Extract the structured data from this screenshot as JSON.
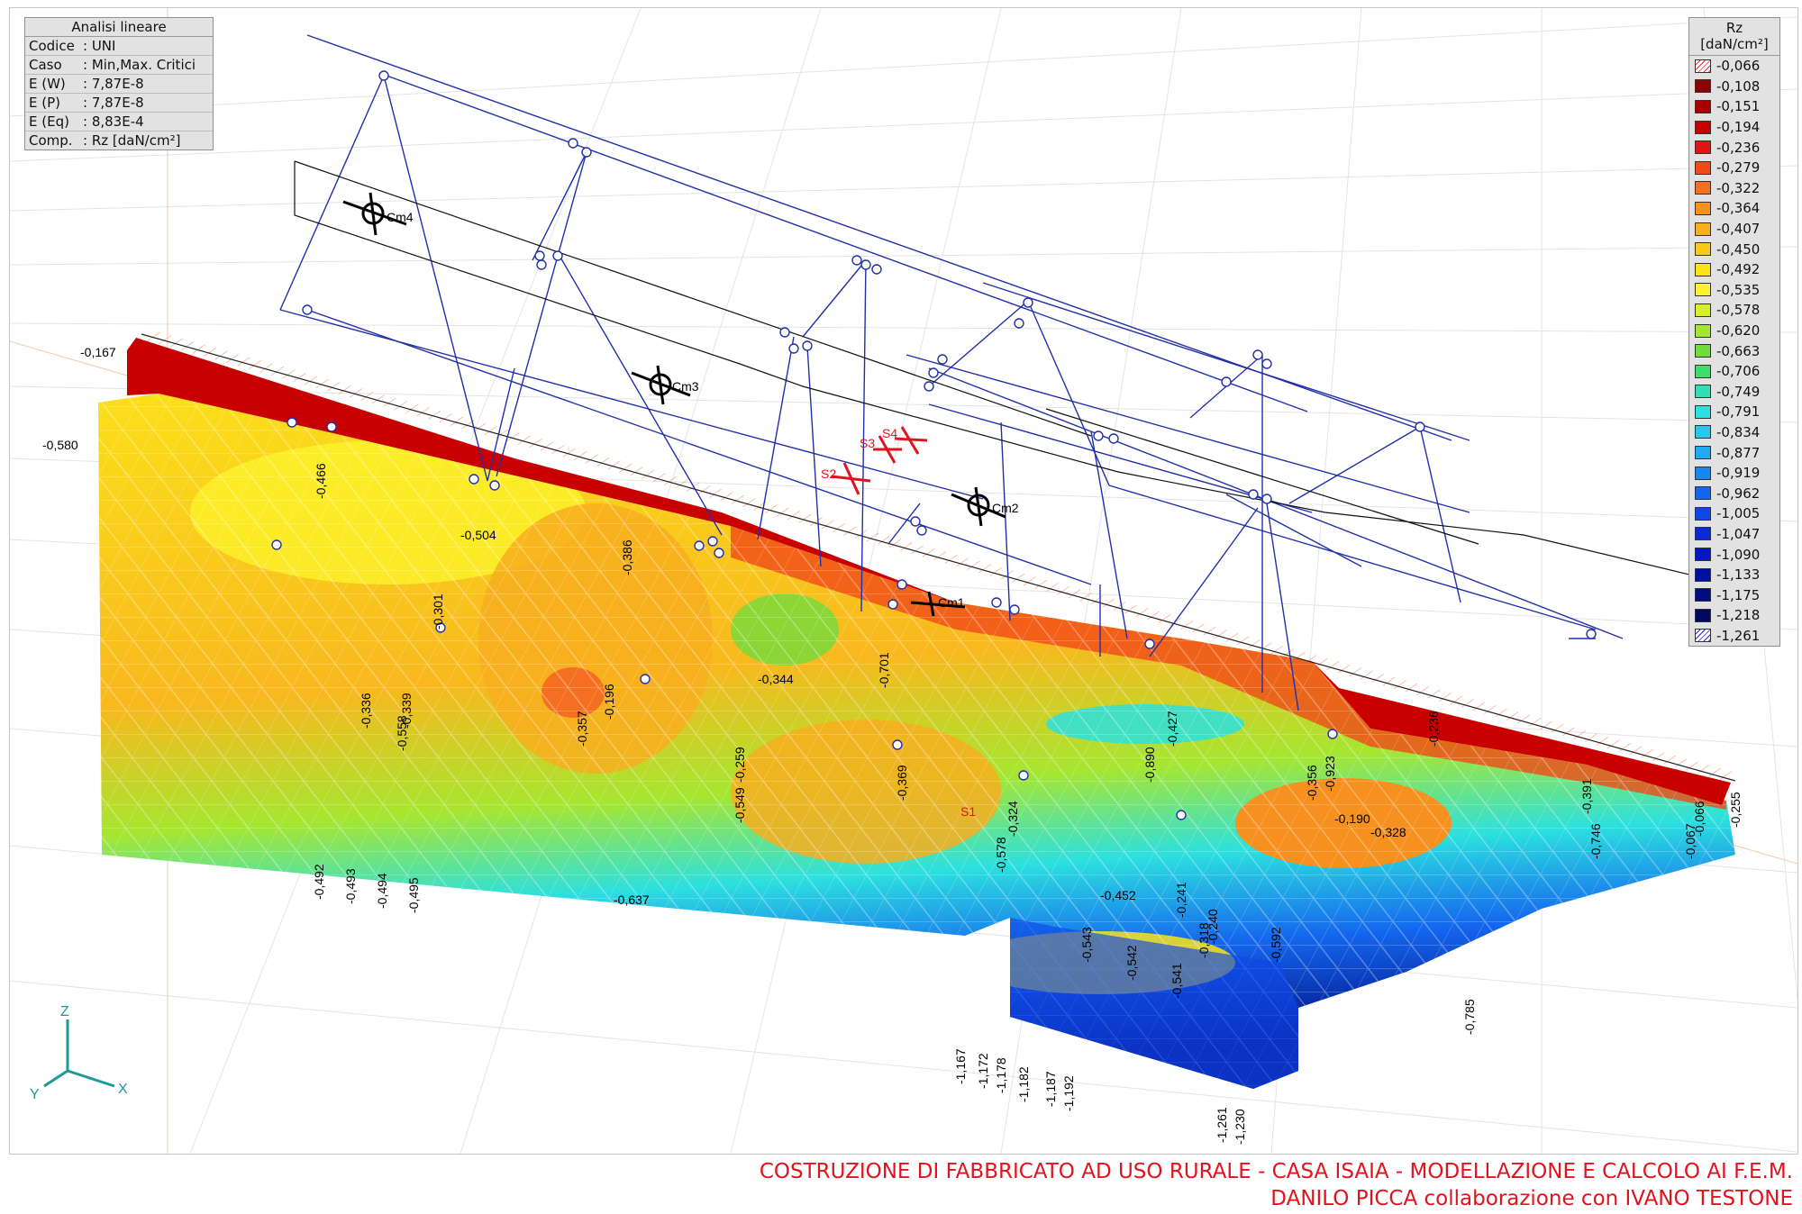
{
  "info_panel": {
    "title": "Analisi lineare",
    "rows": [
      {
        "key": "Codice",
        "value": ": UNI"
      },
      {
        "key": "Caso",
        "value": ": Min,Max. Critici"
      },
      {
        "key": "E (W)",
        "value": ": 7,87E-8"
      },
      {
        "key": "E (P)",
        "value": ": 7,87E-8"
      },
      {
        "key": "E (Eq)",
        "value": ": 8,83E-4"
      },
      {
        "key": "Comp.",
        "value": ": Rz [daN/cm²]"
      }
    ]
  },
  "legend": {
    "title": "Rz",
    "unit": "[daN/cm²]",
    "items": [
      {
        "label": "-0,066",
        "color": "hatch-red"
      },
      {
        "label": "-0,108",
        "color": "#8b0000"
      },
      {
        "label": "-0,151",
        "color": "#a80000"
      },
      {
        "label": "-0,194",
        "color": "#c80000"
      },
      {
        "label": "-0,236",
        "color": "#e01414"
      },
      {
        "label": "-0,279",
        "color": "#f04a18"
      },
      {
        "label": "-0,322",
        "color": "#f47020"
      },
      {
        "label": "-0,364",
        "color": "#f6901f"
      },
      {
        "label": "-0,407",
        "color": "#f8ae1e"
      },
      {
        "label": "-0,450",
        "color": "#fac81a"
      },
      {
        "label": "-0,492",
        "color": "#fbe31a"
      },
      {
        "label": "-0,535",
        "color": "#fbf32a"
      },
      {
        "label": "-0,578",
        "color": "#d6f02a"
      },
      {
        "label": "-0,620",
        "color": "#a6e630"
      },
      {
        "label": "-0,663",
        "color": "#70dc3c"
      },
      {
        "label": "-0,706",
        "color": "#3edc6e"
      },
      {
        "label": "-0,749",
        "color": "#30e0b4"
      },
      {
        "label": "-0,791",
        "color": "#2ce0e0"
      },
      {
        "label": "-0,834",
        "color": "#28c8ec"
      },
      {
        "label": "-0,877",
        "color": "#20aaf0"
      },
      {
        "label": "-0,919",
        "color": "#1886f0"
      },
      {
        "label": "-0,962",
        "color": "#1466ee"
      },
      {
        "label": "-1,005",
        "color": "#1046e6"
      },
      {
        "label": "-1,047",
        "color": "#0a2ad8"
      },
      {
        "label": "-1,090",
        "color": "#0418c0"
      },
      {
        "label": "-1,133",
        "color": "#0010a0"
      },
      {
        "label": "-1,175",
        "color": "#000c80"
      },
      {
        "label": "-1,218",
        "color": "#000860"
      },
      {
        "label": "-1,261",
        "color": "hatch-blue"
      }
    ]
  },
  "nodes": [
    {
      "label": "Cm4"
    },
    {
      "label": "Cm3"
    },
    {
      "label": "Cm2"
    },
    {
      "label": "Cm1"
    },
    {
      "label": "S1"
    },
    {
      "label": "S2"
    },
    {
      "label": "S3"
    },
    {
      "label": "S4"
    }
  ],
  "contour_labels": [
    "-0,167",
    "-0,580",
    "-0,466",
    "-0,504",
    "-0,386",
    "-0,301",
    "-0,336",
    "-0,339",
    "-0,558",
    "-0,196",
    "-0,357",
    "-0,344",
    "-0,701",
    "-0,259",
    "-0,549",
    "-0,369",
    "-0,324",
    "-0,578",
    "-0,452",
    "-0,427",
    "-0,890",
    "-0,356",
    "-0,923",
    "-0,190",
    "-0,328",
    "-0,236",
    "-0,391",
    "-0,746",
    "-0,067",
    "-0,066",
    "-0,255",
    "-0,785",
    "-0,637",
    "-0,492",
    "-0,493",
    "-0,494",
    "-0,495",
    "-0,543",
    "-0,542",
    "-0,541",
    "-0,240",
    "-0,241",
    "-0,318",
    "-0,592",
    "-1,167",
    "-1,172",
    "-1,178",
    "-1,182",
    "-1,187",
    "-1,192",
    "-1,261",
    "-1,230"
  ],
  "axes": {
    "z": "Z",
    "x": "X",
    "y": "Y"
  },
  "footer": {
    "line1": "COSTRUZIONE DI FABBRICATO AD USO RURALE - CASA ISAIA - MODELLAZIONE E CALCOLO AI F.E.M.",
    "line2": "DANILO PICCA collaborazione con IVANO TESTONE"
  }
}
